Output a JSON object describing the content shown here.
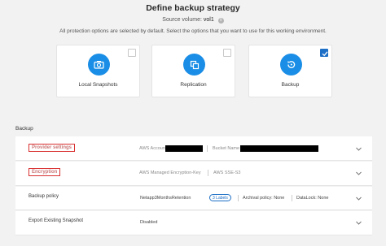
{
  "header": {
    "title": "Define backup strategy",
    "source_volume_label": "Source volume:",
    "source_volume_value": "vol1",
    "info_icon": "info-icon",
    "description": "All protection options are selected by default. Select the options that you want to use for this working environment."
  },
  "options": [
    {
      "label": "Local Snapshots",
      "icon": "camera-icon",
      "checked": false
    },
    {
      "label": "Replication",
      "icon": "copy-icon",
      "checked": false
    },
    {
      "label": "Backup",
      "icon": "restore-icon",
      "checked": true
    }
  ],
  "backup_section": {
    "label": "Backup",
    "rows": {
      "provider": {
        "name": "Provider settings",
        "account_label": "AWS Account",
        "bucket_label": "Bucket Name"
      },
      "encryption": {
        "name": "Encryption",
        "key_value": "AWS Managed Encryption-Key",
        "type_value": "AWS SSE-S3"
      },
      "policy": {
        "name": "Backup policy",
        "policy_value": "Netapp3MonthsRetention",
        "labels_badge": "3 Labels",
        "archival": "Archival policy: None",
        "datalock": "DataLock: None"
      },
      "export": {
        "name": "Export Existing Snapshot",
        "value": "Disabled"
      }
    }
  },
  "colors": {
    "accent": "#1e6fc6",
    "icon_circle": "#1a8ee6",
    "highlight_box": "#d93030",
    "background": "#f2f2f2"
  }
}
